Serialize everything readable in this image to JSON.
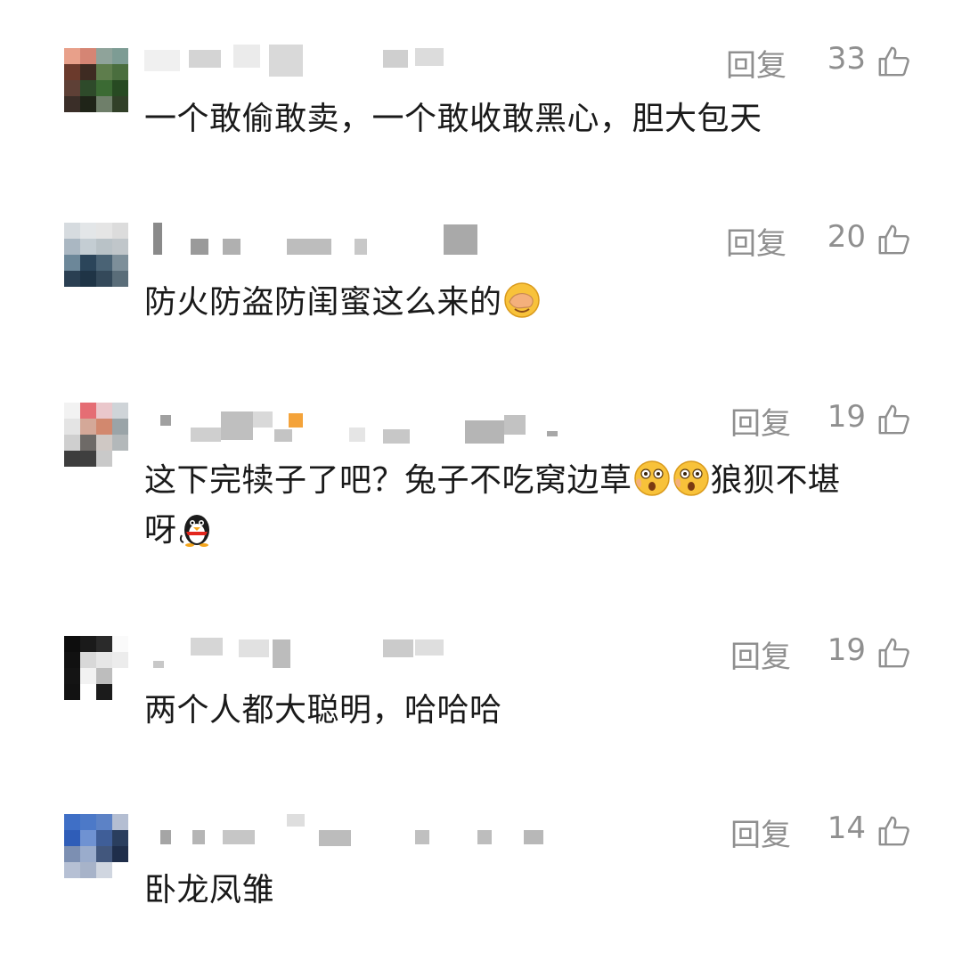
{
  "comments": [
    {
      "text": "一个敢偷敢卖，一个敢收敢黑心，胆大包天",
      "reply": "回复",
      "likes": "33"
    },
    {
      "text": "防火防盗防闺蜜这么来的",
      "reply": "回复",
      "likes": "20",
      "emoji": [
        "face-palm-emoji"
      ]
    },
    {
      "text1": "这下完犊子了吧？兔子不吃窝边草",
      "text2": "狼狈不堪",
      "text3": "呀",
      "reply": "回复",
      "likes": "19",
      "emoji": [
        "shocked-face-emoji",
        "shocked-face-emoji",
        "penguin-emoji"
      ]
    },
    {
      "text": "两个人都大聪明，哈哈哈",
      "reply": "回复",
      "likes": "19"
    },
    {
      "text": "卧龙凤雏",
      "reply": "回复",
      "likes": "14"
    }
  ],
  "icons": {
    "like": "thumbs-up-icon"
  },
  "colors": {
    "meta": "#8f8f8f",
    "text": "#1a1a1a"
  }
}
